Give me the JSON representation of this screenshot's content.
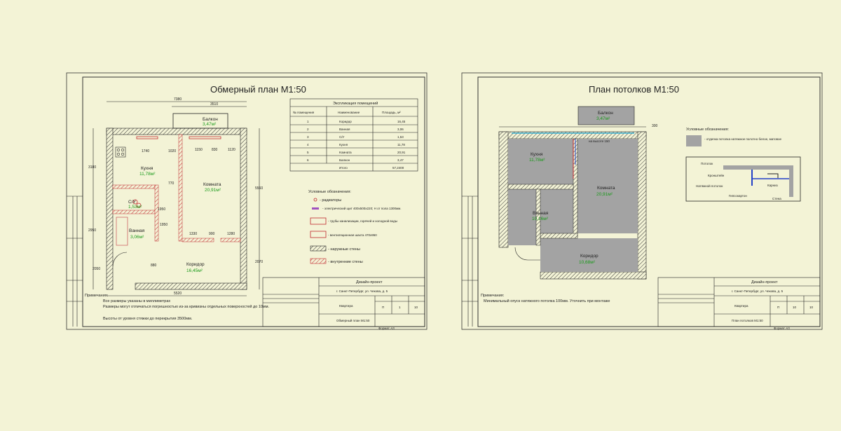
{
  "left_sheet": {
    "title": "Обмерный план М1:50",
    "explication": {
      "caption": "Экспликация помещений",
      "headers": [
        "№ помещения",
        "Наименование",
        "Площадь, м²"
      ],
      "rows": [
        [
          "1",
          "Коридор",
          "16,45"
        ],
        [
          "2",
          "Ванная",
          "3,06"
        ],
        [
          "3",
          "С/У",
          "1,53"
        ],
        [
          "4",
          "Кухня",
          "11,78"
        ],
        [
          "5",
          "Комната",
          "20,91"
        ],
        [
          "6",
          "Балкон",
          "3,47"
        ]
      ],
      "total_label": "Итого",
      "total_value": "57,2400"
    },
    "rooms": {
      "balcony": {
        "name": "Балкон",
        "area": "3,47м²"
      },
      "kitchen": {
        "name": "Кухня",
        "area": "11,78м²"
      },
      "room": {
        "name": "Комната",
        "area": "20,91м²"
      },
      "wc": {
        "name": "С/У",
        "area": "1,53м²"
      },
      "bath": {
        "name": "Ванная",
        "area": "3,06м²"
      },
      "corridor": {
        "name": "Коридор",
        "area": "16,45м²"
      }
    },
    "dims": {
      "top_total": "7380",
      "top_right": "3510",
      "bottom_total": "5520",
      "left_a": "3180",
      "left_b": "2950",
      "right_a": "5560",
      "right_b": "2070",
      "d1": "1740",
      "d2": "1020",
      "d3": "1150",
      "d4": "830",
      "d5": "1120",
      "d6": "1330",
      "d7": "900",
      "d8": "1280",
      "d9": "1950",
      "d10": "770",
      "d11": "1950",
      "d12": "880",
      "d13": "2050"
    },
    "legend": {
      "heading": "Условные обозначения:",
      "items": [
        "- радиаторы",
        "- электрический щит 400х500х220; Н от пола 1300мм.",
        "- трубы канализации, горячей и холодной воды",
        "- вентиляционная шахта 470х950",
        "- наружные стены",
        "- внутренние стены"
      ]
    },
    "notes": {
      "heading": "Примечания:",
      "items": [
        "Все размеры указаны в миллиметрах",
        "Размеры могут отличаться погрешностью из-за кривизны отдельных поверхностей до 10мм.",
        "Высоты от уровня стяжки до перекрытия 3500мм."
      ]
    },
    "stamp": {
      "project": "Дизайн-проект",
      "address": "г. Санкт-Петербург, ул. Чекова, д. 5",
      "object": "Квартира",
      "sheet_name": "Обмерный план М1:50",
      "stage": "П",
      "sheet": "1",
      "sheets": "10",
      "format": "Формат А3"
    }
  },
  "right_sheet": {
    "title": "План потолков М1:50",
    "rooms": {
      "balcony": {
        "name": "Балкон",
        "area": "3,47м²"
      },
      "kitchen": {
        "name": "Кухня",
        "area": "11,78м²"
      },
      "room": {
        "name": "Комната",
        "area": "20,91м²"
      },
      "bath": {
        "name": "Ванная",
        "area": "10,16м²"
      },
      "corridor": {
        "name": "Коридор",
        "area": "10,68м²"
      }
    },
    "dims": {
      "top": "300",
      "note": "на высоте 150"
    },
    "legend": {
      "heading": "Условные обозначения:",
      "item": "- отделка потолка натяжное полотно белое, матовое"
    },
    "detail_labels": [
      "Потолок",
      "Кронштейн",
      "Натяжной потолок",
      "Гипсокартон",
      "Карниз",
      "Стена"
    ],
    "notes": {
      "heading": "Примечания:",
      "items": [
        "Минимальный опуск натяжного потолка 100мм. Уточнить при монтаже"
      ]
    },
    "stamp": {
      "project": "Дизайн-проект",
      "address": "г. Санкт-Петербург, ул. Чекова, д. 5",
      "object": "Квартира",
      "sheet_name": "План потолков М1:50",
      "stage": "П",
      "sheet": "10",
      "sheets": "10",
      "format": "Формат А3"
    }
  },
  "colors": {
    "background": "#f3f3d6",
    "area_text": "#1a9a1a",
    "ceiling_gray": "#a3a3a3",
    "red_accent": "#c0272d",
    "blue_accent": "#2340c8"
  }
}
